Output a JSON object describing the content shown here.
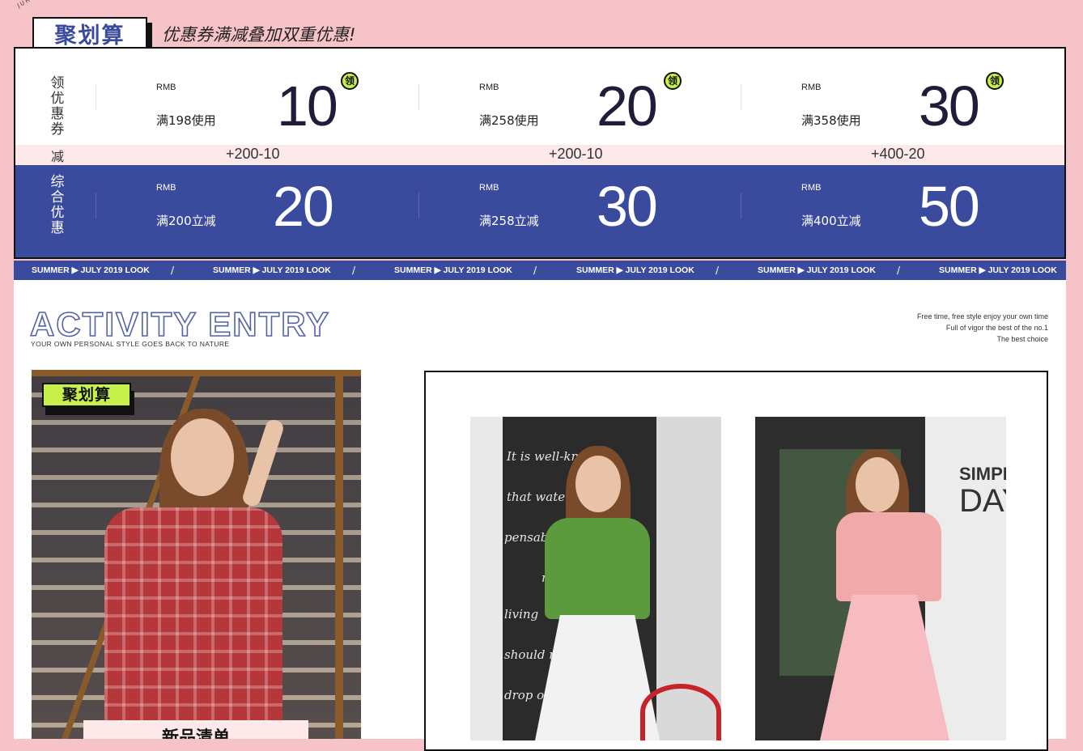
{
  "header": {
    "brand_arc": "JUHUASUAN",
    "logo": "聚划算",
    "headline": "优惠券满减叠加双重优惠!"
  },
  "coupons": {
    "row_label": [
      "领",
      "优",
      "惠",
      "券"
    ],
    "items": [
      {
        "currency": "RMB",
        "condition": "满198使用",
        "amount": "10",
        "badge": "领"
      },
      {
        "currency": "RMB",
        "condition": "满258使用",
        "amount": "20",
        "badge": "领"
      },
      {
        "currency": "RMB",
        "condition": "满358使用",
        "amount": "30",
        "badge": "领"
      }
    ]
  },
  "minus": {
    "label": "减",
    "formulas": [
      "+200-10",
      "+200-10",
      "+400-20"
    ]
  },
  "combined": {
    "row_label": [
      "综",
      "合",
      "优",
      "惠"
    ],
    "items": [
      {
        "currency": "RMB",
        "condition": "满200立减",
        "amount": "20"
      },
      {
        "currency": "RMB",
        "condition": "满258立减",
        "amount": "30"
      },
      {
        "currency": "RMB",
        "condition": "满400立减",
        "amount": "50"
      }
    ]
  },
  "strip": {
    "text": "SUMMER ▶ JULY 2019 LOOK",
    "separator": "/"
  },
  "activity": {
    "title": "ACTIVITY ENTRY",
    "subtitle": "YOUR OWN PERSONAL STYLE GOES BACK TO NATURE",
    "tagline": [
      "Free time, free style enjoy your own time",
      "Full of vigor the best of the no.1",
      "The best choice"
    ]
  },
  "left_card": {
    "tag": "聚划算",
    "banner": "新品清单"
  },
  "photos": {
    "mid_chalk": [
      "It is well-kn",
      "that water",
      "pensable",
      "mod",
      "living",
      "should not",
      "drop of"
    ],
    "right_sign": [
      "SIMPLE",
      "DAY"
    ]
  },
  "colors": {
    "background": "#f6c3c8",
    "brand_blue": "#3a4a9c",
    "lime": "#c8f04a",
    "light_pink": "#fde8ea"
  }
}
